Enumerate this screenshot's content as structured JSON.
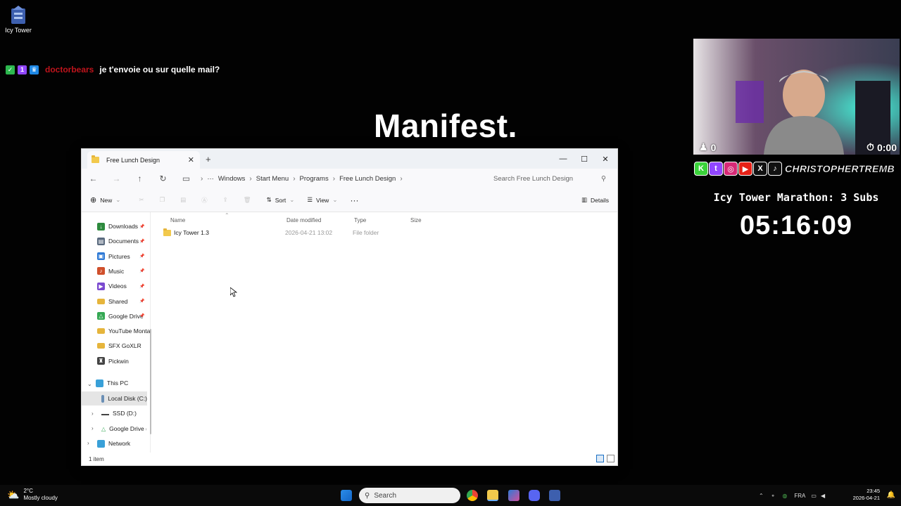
{
  "desktop": {
    "icon_label": "Icy Tower"
  },
  "chat": {
    "username": "doctorbears",
    "message": "je t'envoie ou sur quelle mail?"
  },
  "overlay": {
    "manifest": "Manifest.",
    "webcam_left_count": "0",
    "webcam_right_count": "0:00",
    "social_name": "CHRISTOPHERTREMB",
    "marathon": "Icy Tower Marathon: 3 Subs",
    "timer": "05:16:09"
  },
  "window": {
    "tab_title": "Free Lunch Design",
    "breadcrumbs": [
      "Windows",
      "Start Menu",
      "Programs",
      "Free Lunch Design"
    ],
    "search_placeholder": "Search Free Lunch Design",
    "toolbar": {
      "new": "New",
      "sort": "Sort",
      "view": "View",
      "details": "Details"
    },
    "sidebar": {
      "quick": [
        {
          "label": "Downloads",
          "color": "#2d8a3e",
          "glyph": "↓"
        },
        {
          "label": "Documents",
          "color": "#5a6a7e",
          "glyph": "▤"
        },
        {
          "label": "Pictures",
          "color": "#2f7ad6",
          "glyph": "▣"
        },
        {
          "label": "Music",
          "color": "#d0502c",
          "glyph": "♪"
        },
        {
          "label": "Videos",
          "color": "#7b4ad0",
          "glyph": "▶"
        },
        {
          "label": "Shared",
          "color": "#e6b53c",
          "glyph": ""
        },
        {
          "label": "Google Drive",
          "color": "#34a853",
          "glyph": "△"
        },
        {
          "label": "YouTube Monta",
          "color": "#e6b53c",
          "glyph": ""
        },
        {
          "label": "SFX GoXLR",
          "color": "#e6b53c",
          "glyph": ""
        },
        {
          "label": "Pickwin",
          "color": "#444444",
          "glyph": "♜"
        }
      ],
      "this_pc": "This PC",
      "drives": [
        "Local Disk (C:)",
        "SSD (D:)",
        "Google Drive ("
      ],
      "network": "Network"
    },
    "columns": {
      "name": "Name",
      "date": "Date modified",
      "type": "Type",
      "size": "Size"
    },
    "files": [
      {
        "name": "Icy Tower 1.3",
        "date": "2026-04-21 13:02",
        "type": "File folder",
        "size": ""
      }
    ],
    "status": "1 item"
  },
  "taskbar": {
    "temperature": "2°C",
    "weather": "Mostly cloudy",
    "search": "Search",
    "language": "FRA",
    "time": "23:45",
    "date": "2026-04-21"
  }
}
